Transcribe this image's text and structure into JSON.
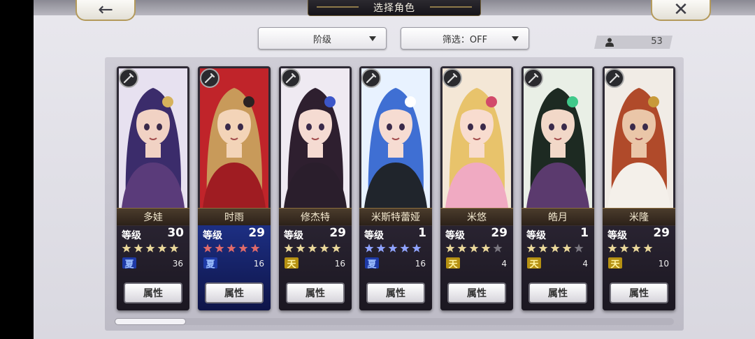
{
  "header": {
    "title": "选择角色",
    "back_icon": "←",
    "close_icon": "✕"
  },
  "filters": {
    "class_label": "阶级",
    "filter_label": "筛选：OFF"
  },
  "count": "53",
  "level_label": "等级",
  "attr_label": "属性",
  "colors": {
    "star_gold": "#e9d79a",
    "star_grey": "#7a7780",
    "star_red": "#e06a6a",
    "star_blue": "#8fa3ff"
  },
  "characters": [
    {
      "name": "多娃",
      "level": "30",
      "element": "夏",
      "count": "36"
    },
    {
      "name": "时雨",
      "level": "29",
      "element": "夏",
      "count": "16"
    },
    {
      "name": "修杰特",
      "level": "29",
      "element": "天",
      "count": "16"
    },
    {
      "name": "米斯特蕾娅",
      "level": "1",
      "element": "夏",
      "count": "16"
    },
    {
      "name": "米悠",
      "level": "29",
      "element": "天",
      "count": "4"
    },
    {
      "name": "皓月",
      "level": "1",
      "element": "天",
      "count": "4"
    },
    {
      "name": "米隆",
      "level": "29",
      "element": "天",
      "count": "10"
    }
  ]
}
